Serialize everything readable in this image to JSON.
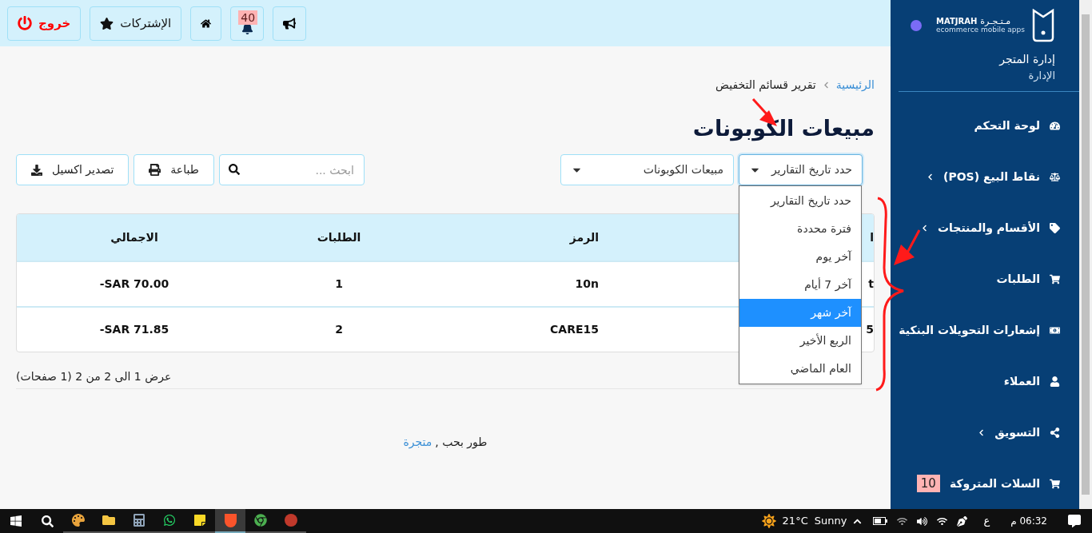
{
  "top_bar": {
    "buttons": [
      {
        "kind": "announcements"
      },
      {
        "kind": "notifications",
        "badge": "40"
      },
      {
        "kind": "home"
      },
      {
        "kind": "subscriptions",
        "label": "الإشتركات"
      },
      {
        "kind": "logout",
        "label": "خروج"
      }
    ]
  },
  "breadcrumb": {
    "home": "الرئيسية",
    "current": "تقرير قسائم التخفيض"
  },
  "title": "مبيعات الكوبونات",
  "filters": [
    {
      "label": "حدد تاريخ التقارير",
      "expanded": true,
      "options": [
        {
          "label": "حدد تاريخ التقارير",
          "selected": false
        },
        {
          "label": "فترة محددة",
          "selected": false
        },
        {
          "label": "آخر يوم",
          "selected": false
        },
        {
          "label": "آخر 7 أيام",
          "selected": false
        },
        {
          "label": "آخر شهر",
          "selected": true
        },
        {
          "label": "الربع الأخير",
          "selected": false
        },
        {
          "label": "العام الماضي",
          "selected": false
        }
      ]
    },
    {
      "label": "مبيعات الكوبونات",
      "expanded": false
    }
  ],
  "search": {
    "placeholder": "ابحث ..."
  },
  "actions": [
    {
      "kind": "print",
      "label": "طباعة"
    },
    {
      "kind": "export",
      "label": "تصدير اكسيل"
    }
  ],
  "table": {
    "columns": [
      "ا",
      "الرمز",
      "الطلبات",
      "الاجمالي"
    ],
    "rows": [
      [
        "t",
        "10n",
        "1",
        "SAR 70.00-"
      ],
      [
        "5",
        "CARE15",
        "2",
        "SAR 71.85-"
      ]
    ]
  },
  "pagination_info": "عرض 1 الى 2 من 2 (1 صفحات)",
  "footer": {
    "text": "طور بحب ,",
    "link": "متجرة"
  },
  "sidebar": {
    "logo": {
      "name": "MATJRAH",
      "arabic": "مـتـجـرة",
      "tagline": "ecommerce mobile apps"
    },
    "store": {
      "name": "إدارة المتجر",
      "role": "الإدارة"
    },
    "items": [
      {
        "label": "لوحة التحكم",
        "has_submenu": false
      },
      {
        "label": "نقاط البيع (POS)",
        "has_submenu": true
      },
      {
        "label": "الأقسام والمنتجات",
        "has_submenu": true
      },
      {
        "label": "الطلبات",
        "has_submenu": false
      },
      {
        "label": "إشعارات التحويلات البنكية",
        "has_submenu": false
      },
      {
        "label": "العملاء",
        "has_submenu": false
      },
      {
        "label": "التسويق",
        "has_submenu": true
      },
      {
        "label": "السلات المتروكة",
        "has_submenu": false,
        "badge": "10"
      }
    ]
  },
  "taskbar": {
    "apps": [
      {
        "selected": false
      },
      {
        "selected": false
      },
      {
        "selected": false
      },
      {
        "selected": false
      },
      {
        "selected": false
      },
      {
        "selected": true
      },
      {
        "selected": false
      },
      {
        "selected": false
      }
    ],
    "temperature": "21°C",
    "weather": "Sunny",
    "language": "ع",
    "time": "06:32 م"
  }
}
